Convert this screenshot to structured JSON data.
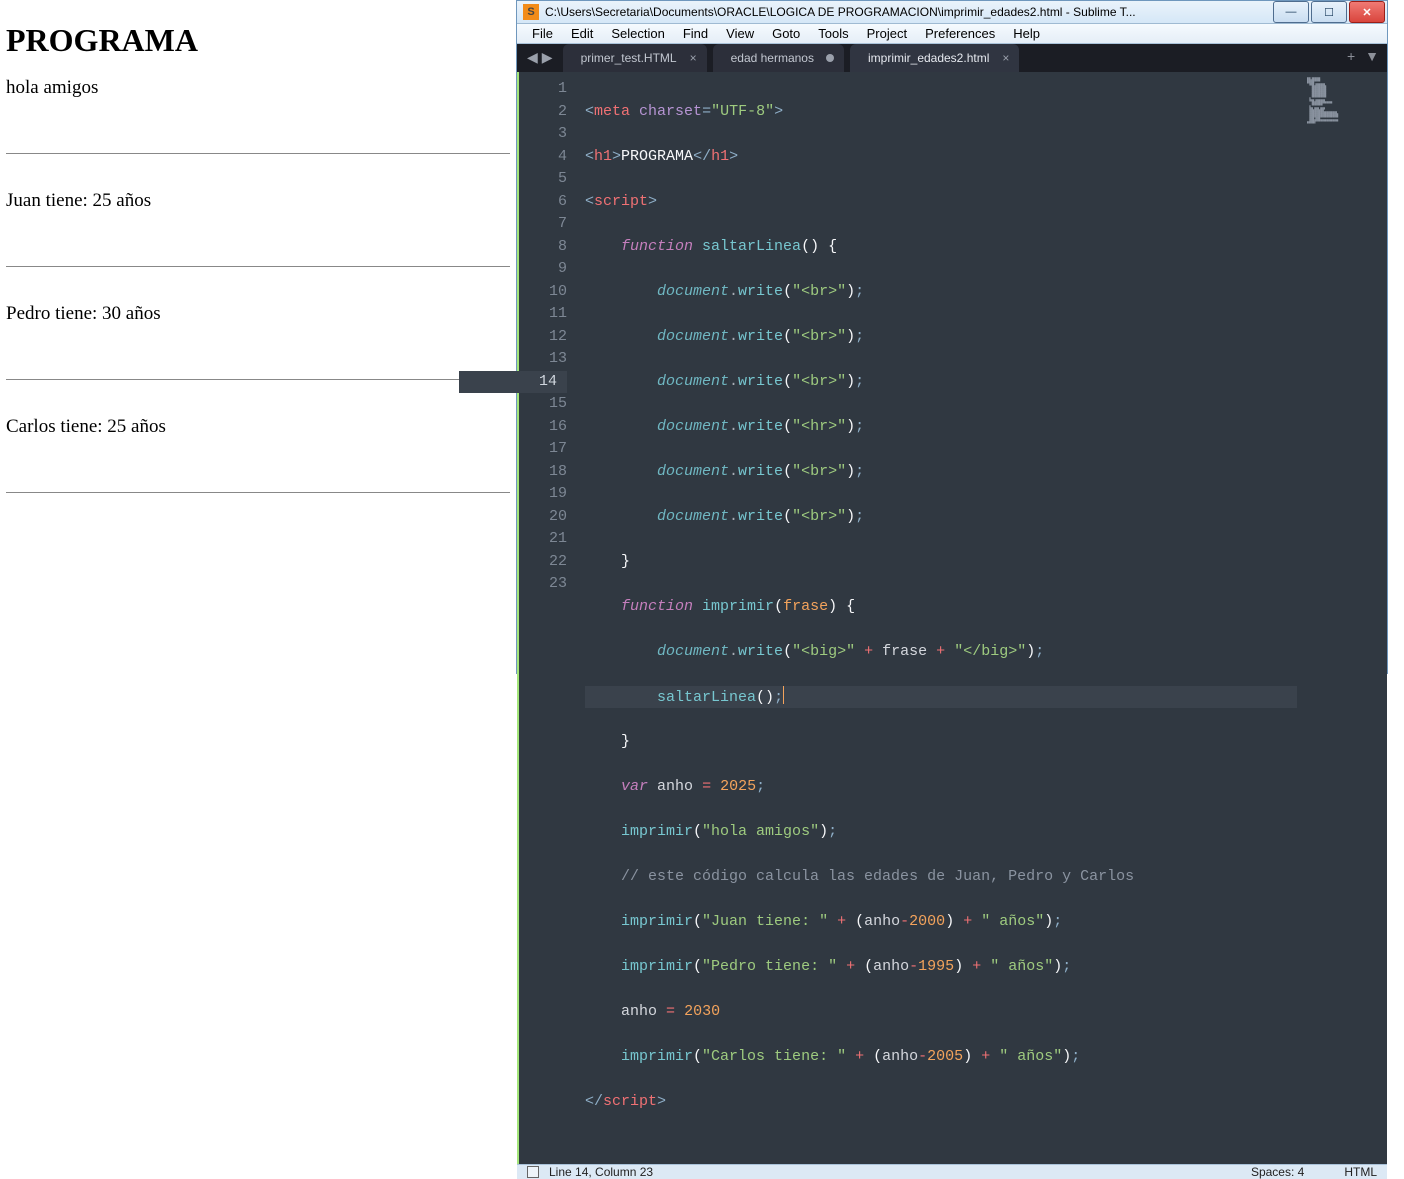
{
  "browser": {
    "heading": "PROGRAMA",
    "line1": "hola amigos",
    "line2": "Juan tiene: 25 años",
    "line3": "Pedro tiene: 30 años",
    "line4": "Carlos tiene: 25 años"
  },
  "sublime": {
    "title": "C:\\Users\\Secretaria\\Documents\\ORACLE\\LOGICA DE PROGRAMACION\\imprimir_edades2.html - Sublime T...",
    "menu": {
      "file": "File",
      "edit": "Edit",
      "selection": "Selection",
      "find": "Find",
      "view": "View",
      "goto": "Goto",
      "tools": "Tools",
      "project": "Project",
      "preferences": "Preferences",
      "help": "Help"
    },
    "tabs": {
      "t1": "primer_test.HTML",
      "t2": "edad hermanos",
      "t3": "imprimir_edades2.html"
    },
    "status": {
      "linecol": "Line 14, Column 23",
      "spaces": "Spaces: 4",
      "lang": "HTML"
    },
    "code": {
      "l1_tag": "meta",
      "l1_attr": "charset",
      "l1_val": "\"UTF-8\"",
      "l2_tag": "h1",
      "l2_text": "PROGRAMA",
      "l3_tag": "script",
      "l4_kw": "function",
      "l4_name": "saltarLinea",
      "l5_obj": "document",
      "l5_m": "write",
      "l5_arg": "\"<br>\"",
      "l6_arg": "\"<br>\"",
      "l7_arg": "\"<br>\"",
      "l8_arg": "\"<hr>\"",
      "l9_arg": "\"<br>\"",
      "l10_arg": "\"<br>\"",
      "l12_kw": "function",
      "l12_name": "imprimir",
      "l12_param": "frase",
      "l13_arg1": "\"<big>\"",
      "l13_arg2": "\"</big>\"",
      "l14_call": "saltarLinea",
      "l16_kw": "var",
      "l16_name": "anho",
      "l16_val": "2025",
      "l17_call": "imprimir",
      "l17_arg": "\"hola amigos\"",
      "l18_cmt": "// este código calcula las edades de Juan, Pedro y Carlos",
      "l19_arg1": "\"Juan tiene: \"",
      "l19_num": "2000",
      "l19_arg2": "\" años\"",
      "l20_arg1": "\"Pedro tiene: \"",
      "l20_num": "1995",
      "l20_arg2": "\" años\"",
      "l21_name": "anho",
      "l21_val": "2030",
      "l22_arg1": "\"Carlos tiene: \"",
      "l22_num": "2005",
      "l22_arg2": "\" años\""
    }
  }
}
